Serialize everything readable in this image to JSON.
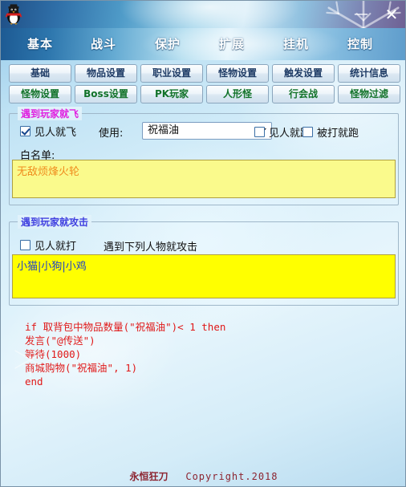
{
  "window": {
    "app_icon": "penguin-icon",
    "minimize_label": "—",
    "close_label": "✕"
  },
  "main_menu": {
    "items": [
      {
        "label": "基本"
      },
      {
        "label": "战斗"
      },
      {
        "label": "保护"
      },
      {
        "label": "扩展"
      },
      {
        "label": "挂机"
      },
      {
        "label": "控制"
      }
    ]
  },
  "tab_row_1": {
    "items": [
      {
        "label": "基础"
      },
      {
        "label": "物品设置"
      },
      {
        "label": "职业设置"
      },
      {
        "label": "怪物设置"
      },
      {
        "label": "触发设置"
      },
      {
        "label": "统计信息"
      }
    ]
  },
  "tab_row_2": {
    "items": [
      {
        "label": "怪物设置"
      },
      {
        "label": "Boss设置"
      },
      {
        "label": "PK玩家"
      },
      {
        "label": "人形怪"
      },
      {
        "label": "行会战"
      },
      {
        "label": "怪物过滤"
      }
    ]
  },
  "flee_group": {
    "title": "遇到玩家就飞",
    "title_color": "#e020e0",
    "checkbox_flee_on_sight": {
      "label": "见人就飞",
      "checked": true
    },
    "use_label": "使用:",
    "item_combo": {
      "value": "祝福油"
    },
    "checkbox_run_on_sight": {
      "label": "见人就跑",
      "checked": false
    },
    "checkbox_run_when_hit": {
      "label": "被打就跑",
      "checked": false
    },
    "whitelist_label": "白名单:",
    "whitelist_value": "无敌烦烽火轮",
    "whitelist_text_color": "#ef8c1e"
  },
  "attack_group": {
    "title": "遇到玩家就攻击",
    "title_color": "#4040e0",
    "checkbox_attack_on_sight": {
      "label": "见人就打",
      "checked": false
    },
    "attack_list_label": "遇到下列人物就攻击",
    "attack_list_value": "小猫|小狗|小鸡",
    "attack_list_text_color": "#1e40c8"
  },
  "script": {
    "text": "if 取背包中物品数量(\"祝福油\")< 1 then\n发言(\"@传送\")\n等待(1000)\n商城购物(\"祝福油\", 1)\nend",
    "color": "#e01818"
  },
  "footer": {
    "brand": "永恒狂刀",
    "copyright": "Copyright.2018"
  }
}
